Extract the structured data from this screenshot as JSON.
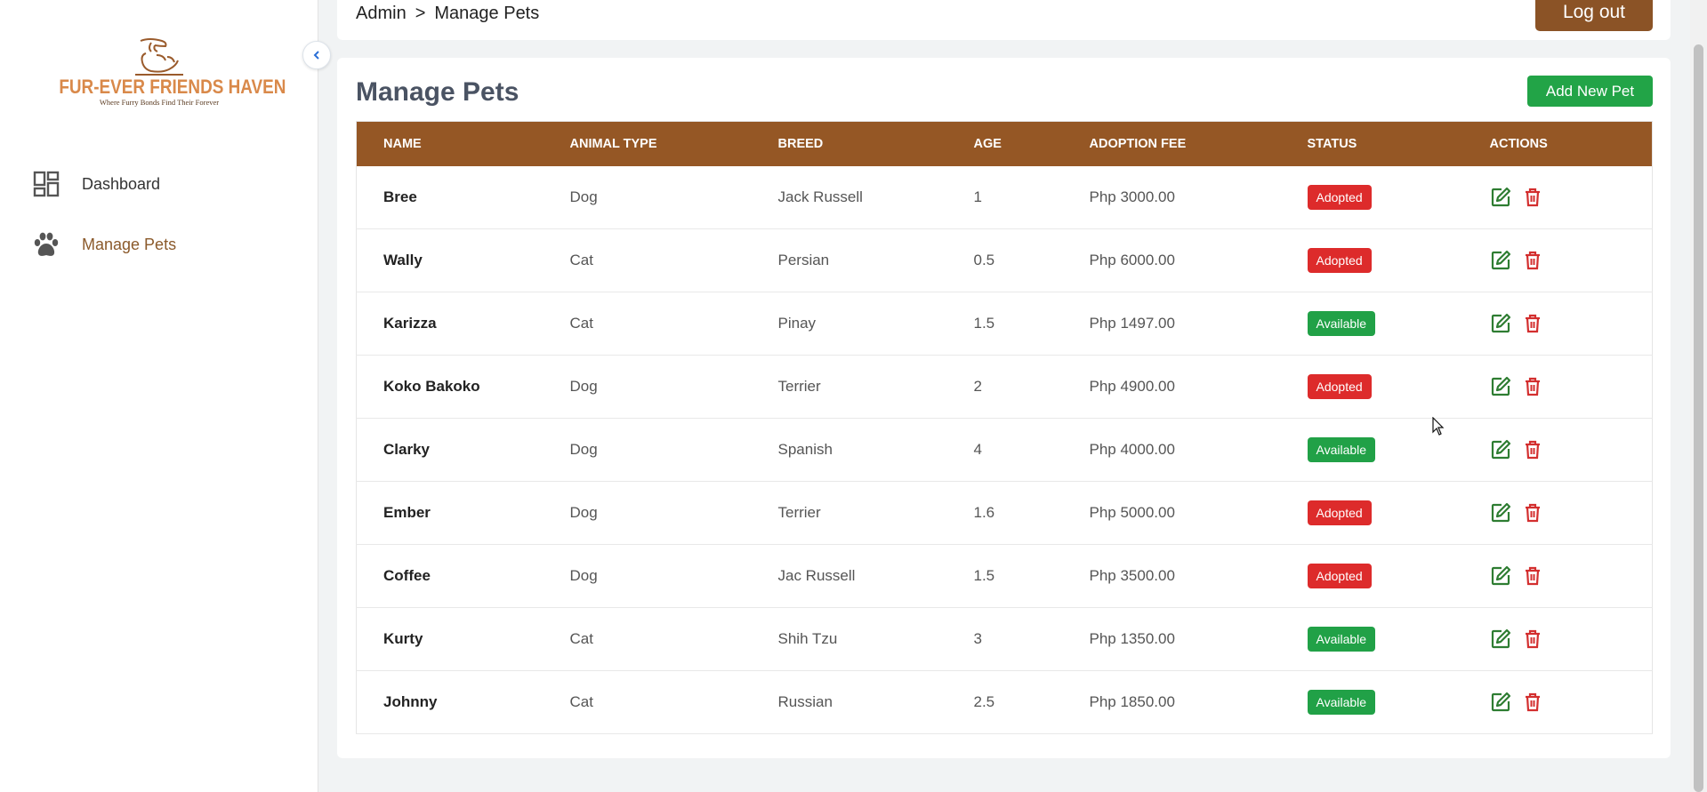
{
  "app": {
    "logo_title": "FUR-EVER FRIENDS HAVEN",
    "logo_tagline": "Where Furry Bonds Find Their Forever"
  },
  "sidebar": {
    "items": [
      {
        "label": "Dashboard",
        "icon": "dashboard-icon",
        "active": false
      },
      {
        "label": "Manage Pets",
        "icon": "paw-icon",
        "active": true
      }
    ]
  },
  "header": {
    "breadcrumb": [
      "Admin",
      ">",
      "Manage Pets"
    ],
    "logout_label": "Log out"
  },
  "main": {
    "title": "Manage Pets",
    "add_button_label": "Add New Pet",
    "columns": [
      "NAME",
      "ANIMAL TYPE",
      "BREED",
      "AGE",
      "ADOPTION FEE",
      "STATUS",
      "ACTIONS"
    ],
    "rows": [
      {
        "name": "Bree",
        "type": "Dog",
        "breed": "Jack Russell",
        "age": "1",
        "fee": "Php 3000.00",
        "status": "Adopted"
      },
      {
        "name": "Wally",
        "type": "Cat",
        "breed": "Persian",
        "age": "0.5",
        "fee": "Php 6000.00",
        "status": "Adopted"
      },
      {
        "name": "Karizza",
        "type": "Cat",
        "breed": "Pinay",
        "age": "1.5",
        "fee": "Php 1497.00",
        "status": "Available"
      },
      {
        "name": "Koko Bakoko",
        "type": "Dog",
        "breed": "Terrier",
        "age": "2",
        "fee": "Php 4900.00",
        "status": "Adopted"
      },
      {
        "name": "Clarky",
        "type": "Dog",
        "breed": "Spanish",
        "age": "4",
        "fee": "Php 4000.00",
        "status": "Available"
      },
      {
        "name": "Ember",
        "type": "Dog",
        "breed": "Terrier",
        "age": "1.6",
        "fee": "Php 5000.00",
        "status": "Adopted"
      },
      {
        "name": "Coffee",
        "type": "Dog",
        "breed": "Jac Russell",
        "age": "1.5",
        "fee": "Php 3500.00",
        "status": "Adopted"
      },
      {
        "name": "Kurty",
        "type": "Cat",
        "breed": "Shih Tzu",
        "age": "3",
        "fee": "Php 1350.00",
        "status": "Available"
      },
      {
        "name": "Johnny",
        "type": "Cat",
        "breed": "Russian",
        "age": "2.5",
        "fee": "Php 1850.00",
        "status": "Available"
      }
    ]
  },
  "colors": {
    "brand_brown": "#955725",
    "logout_brown": "#8b5326",
    "adopted_red": "#dd2b2b",
    "available_green": "#21a147",
    "action_green": "#2e7d32",
    "delete_red": "#d32f2f"
  }
}
